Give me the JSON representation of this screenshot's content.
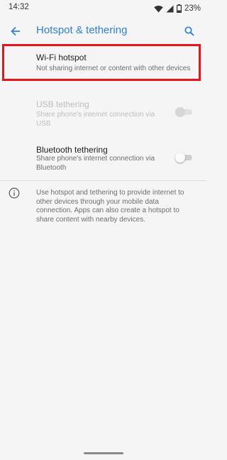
{
  "status_bar": {
    "time": "14:32",
    "battery_percent": "23%",
    "icons": [
      "wifi-icon",
      "signal-icon",
      "battery-icon"
    ]
  },
  "app_bar": {
    "title": "Hotspot & tethering",
    "back_icon": "arrow-back-icon",
    "search_icon": "search-icon"
  },
  "preferences": {
    "wifi_hotspot": {
      "title": "Wi-Fi hotspot",
      "summary": "Not sharing internet or content with other devices",
      "highlighted": true
    },
    "usb_tethering": {
      "title": "USB tethering",
      "summary": "Share phone's internet connection via USB",
      "enabled": false,
      "checked": false
    },
    "bluetooth_tethering": {
      "title": "Bluetooth tethering",
      "summary": "Share phone's internet connection via Bluetooth",
      "enabled": true,
      "checked": false
    }
  },
  "footer": {
    "info_icon": "info-icon",
    "text": "Use hotspot and tethering to provide internet to other devices through your mobile data connection. Apps can also create a hotspot to share content with nearby devices."
  },
  "colors": {
    "accent": "#2f7fd6",
    "background": "#f5f5f5",
    "highlight": "#e8141c"
  }
}
